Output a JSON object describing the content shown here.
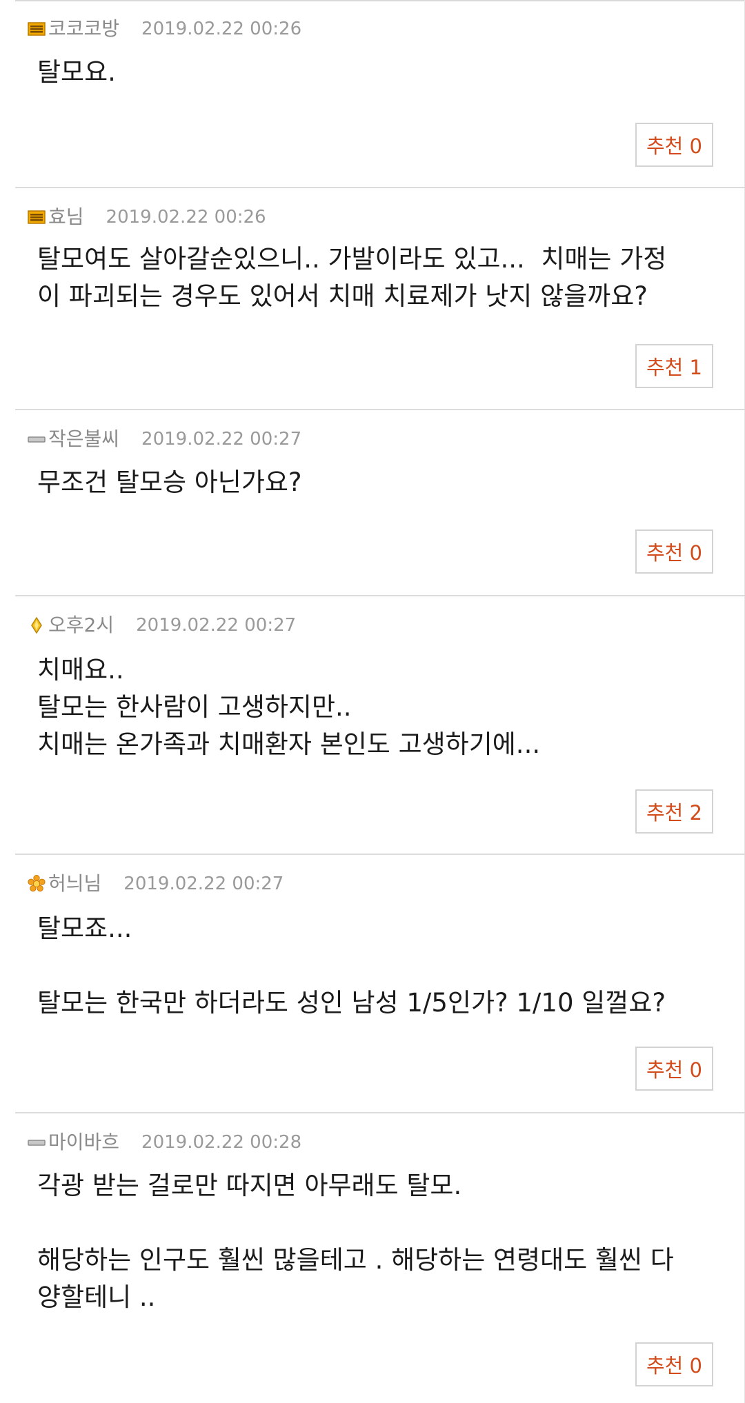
{
  "comments": [
    {
      "author": "코코코방",
      "badge": "gold-bars-icon",
      "date": "2019.02.22 00:26",
      "lines": [
        "탈모요."
      ],
      "vote_label": "추천 0"
    },
    {
      "author": "효님",
      "badge": "gold-bars-icon",
      "date": "2019.02.22 00:26",
      "lines": [
        "탈모여도 살아갈순있으니.. 가발이라도 있고...  치매는 가정",
        "이 파괴되는 경우도 있어서 치매 치료제가 낫지 않을까요?"
      ],
      "vote_label": "추천 1"
    },
    {
      "author": "작은불씨",
      "badge": "gray-bar-icon",
      "date": "2019.02.22 00:27",
      "lines": [
        "무조건 탈모승 아닌가요?"
      ],
      "vote_label": "추천 0"
    },
    {
      "author": "오후2시",
      "badge": "yellow-diamond-icon",
      "date": "2019.02.22 00:27",
      "lines": [
        "치매요..",
        "탈모는 한사람이 고생하지만..",
        "치매는 온가족과 치매환자 본인도 고생하기에..."
      ],
      "vote_label": "추천 2"
    },
    {
      "author": "허늬님",
      "badge": "orange-flower-icon",
      "date": "2019.02.22 00:27",
      "lines": [
        "탈모죠...",
        "",
        "탈모는 한국만 하더라도 성인 남성 1/5인가? 1/10 일껄요?"
      ],
      "vote_label": "추천 0"
    },
    {
      "author": "마이바흐",
      "badge": "gray-bar-icon",
      "date": "2019.02.22 00:28",
      "lines": [
        "각광 받는 걸로만 따지면 아무래도 탈모.",
        "",
        "해당하는 인구도 훨씬 많을테고 . 해당하는 연령대도 훨씬 다",
        "양할테니 .."
      ],
      "vote_label": "추천 0"
    }
  ],
  "colors": {
    "vote_text": "#d24b1a",
    "divider": "#dcdcdc",
    "meta_text": "#8a8a8a"
  }
}
